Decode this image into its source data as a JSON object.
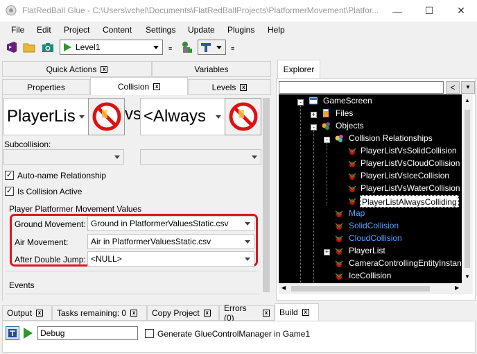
{
  "title": "FlatRedBall Glue - C:\\Users\\vchel\\Documents\\FlatRedBallProjects\\PlatformerMovement\\Platfor...",
  "menu": [
    "File",
    "Edit",
    "Project",
    "Content",
    "Settings",
    "Update",
    "Plugins",
    "Help"
  ],
  "toolbar": {
    "level": "Level1"
  },
  "left_tabs": {
    "row1": [
      "Quick Actions",
      "Variables"
    ],
    "row2": [
      "Properties",
      "Collision",
      "Levels"
    ]
  },
  "collision": {
    "first": "PlayerLis",
    "vs": "vs",
    "second": "<Always",
    "subcollision_label": "Subcollision:",
    "auto_name": "Auto-name Relationship",
    "active": "Is Collision Active",
    "group_label": "Player Platformer Movement Values",
    "ground_label": "Ground Movement:",
    "ground_value": "Ground in PlatformerValuesStatic.csv",
    "air_label": "Air Movement:",
    "air_value": "Air in PlatformerValuesStatic.csv",
    "jump_label": "After Double Jump:",
    "jump_value": "<NULL>",
    "events_label": "Events"
  },
  "explorer": {
    "tab": "Explorer",
    "nodes": [
      {
        "label": "GameScreen",
        "style": "white"
      },
      {
        "label": "Files",
        "style": "white"
      },
      {
        "label": "Objects",
        "style": "white"
      },
      {
        "label": "Collision Relationships",
        "style": "white"
      },
      {
        "label": "PlayerListVsSolidCollision",
        "style": "white"
      },
      {
        "label": "PlayerListVsCloudCollision",
        "style": "white"
      },
      {
        "label": "PlayerListVsIceCollision",
        "style": "white"
      },
      {
        "label": "PlayerListVsWaterCollision",
        "style": "white"
      },
      {
        "label": "PlayerListAlwaysColliding",
        "style": "selected"
      },
      {
        "label": "Map",
        "style": "blue"
      },
      {
        "label": "SolidCollision",
        "style": "blue"
      },
      {
        "label": "CloudCollision",
        "style": "blue"
      },
      {
        "label": "PlayerList",
        "style": "white"
      },
      {
        "label": "CameraControllingEntityInstan",
        "style": "white"
      },
      {
        "label": "IceCollision",
        "style": "white"
      }
    ]
  },
  "bottom_tabs": [
    "Output",
    "Tasks remaining: 0",
    "Copy Project",
    "Errors (0)",
    "Build"
  ],
  "bottom": {
    "config": "Debug",
    "generate": "Generate GlueControlManager in Game1"
  },
  "colors": {
    "highlight": "#e0141e",
    "blue_node": "#5aa0ff",
    "tree_bg": "#000000"
  }
}
